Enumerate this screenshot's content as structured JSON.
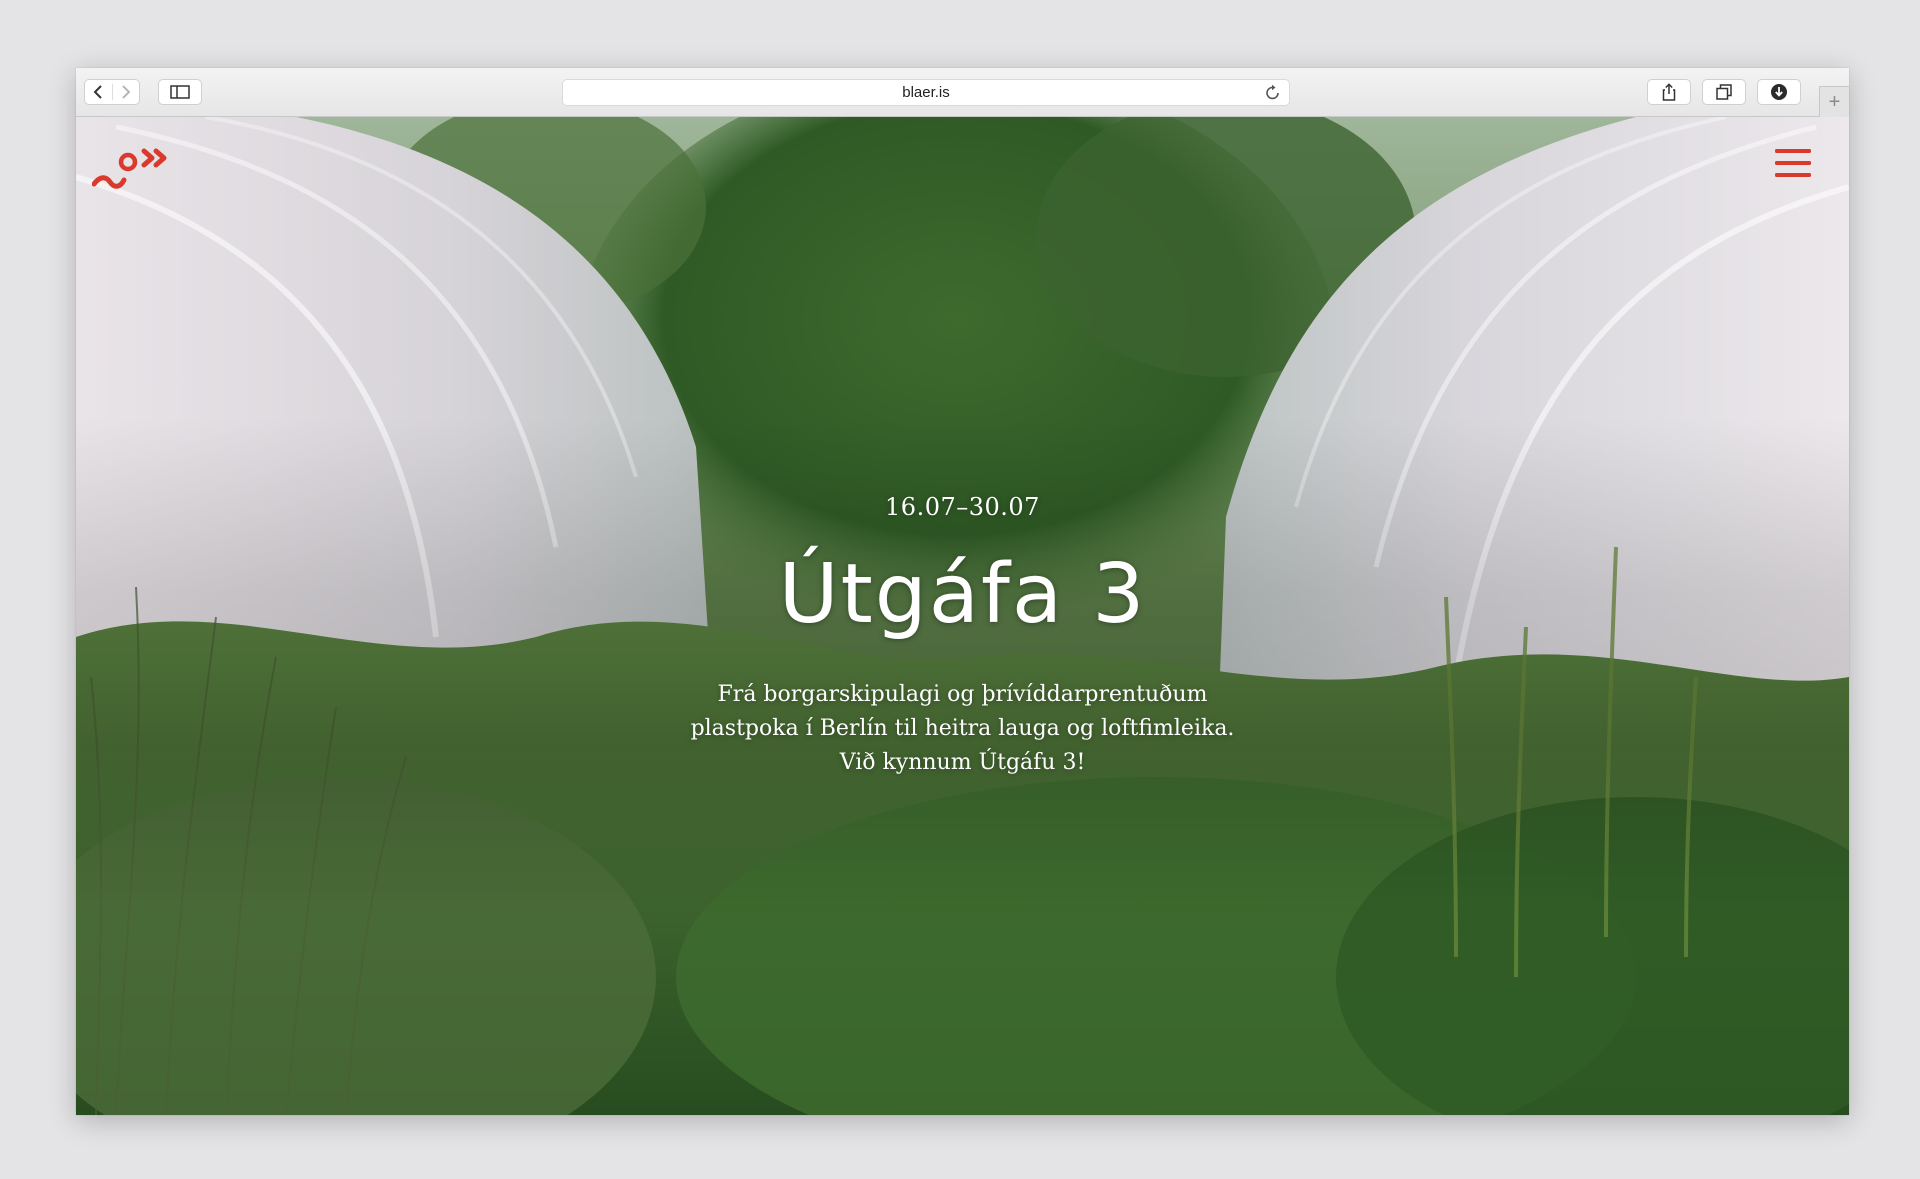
{
  "browser": {
    "url": "blaer.is",
    "new_tab_label": "+"
  },
  "site": {
    "accent_color": "#d93a2b",
    "logo_icon": "blaer-logo-icon",
    "menu_icon": "hamburger-menu-icon"
  },
  "hero": {
    "date_range": "16.07–30.07",
    "title": "Útgáfa 3",
    "description_lines": [
      "Frá borgarskipulagi og þrívíddarprentuðum",
      "plastpoka í Berlín til heitra lauga og loftfimleika.",
      "Við kynnum Útgáfu 3!"
    ]
  }
}
